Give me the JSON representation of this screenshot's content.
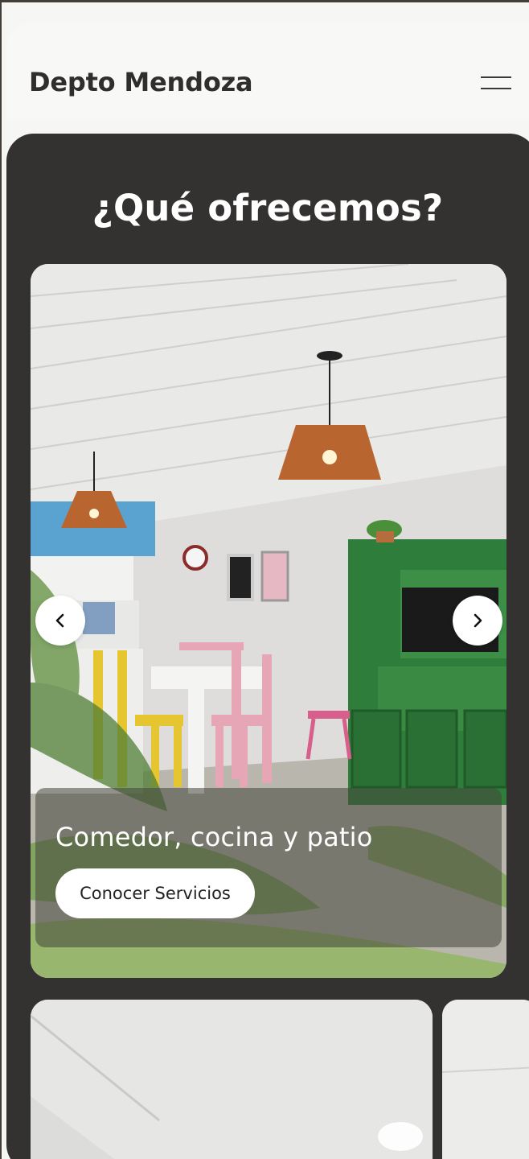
{
  "header": {
    "brand": "Depto Mendoza",
    "menu_icon": "hamburger-menu-icon"
  },
  "section": {
    "title": "¿Qué ofrecemos?"
  },
  "carousel": {
    "prev_icon": "chevron-left-icon",
    "next_icon": "chevron-right-icon",
    "active_slide": {
      "title": "Comedor, cocina y patio",
      "button_label": "Conocer Servicios"
    }
  },
  "colors": {
    "section_bg": "#343230",
    "page_bg": "#f6f6f4",
    "brand_text": "#2f2e2c",
    "cabinet_green": "#2f7d3a",
    "chair_yellow": "#e6c630",
    "chair_pink": "#e6a6b6",
    "lamp_wood": "#b8652f"
  }
}
